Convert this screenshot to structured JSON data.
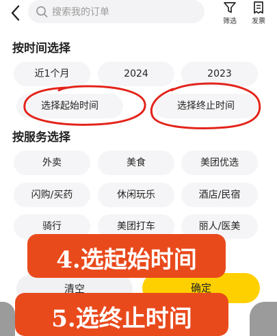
{
  "search": {
    "placeholder": "搜索我的订单"
  },
  "toolbar": {
    "filter_label": "筛选",
    "invoice_label": "发票"
  },
  "time_section": {
    "title": "按时间选择",
    "options": [
      "近1个月",
      "2024",
      "2023"
    ],
    "start_label": "选择起始时间",
    "end_label": "选择终止时间"
  },
  "service_section": {
    "title": "按服务选择",
    "items": [
      "外卖",
      "美食",
      "美团优选",
      "闪购/买药",
      "休闲玩乐",
      "酒店/民宿",
      "骑行",
      "美团打车",
      "丽人/医美"
    ]
  },
  "footer": {
    "clear_label": "清空",
    "confirm_label": "确定"
  },
  "annotations": {
    "step4": "4.选起始时间",
    "step5": "5.选终止时间",
    "circle_color": "#e3241b"
  },
  "colors": {
    "accent": "#ffd000",
    "banner": "#e94a1c",
    "chip_bg": "#f5f5f7"
  }
}
